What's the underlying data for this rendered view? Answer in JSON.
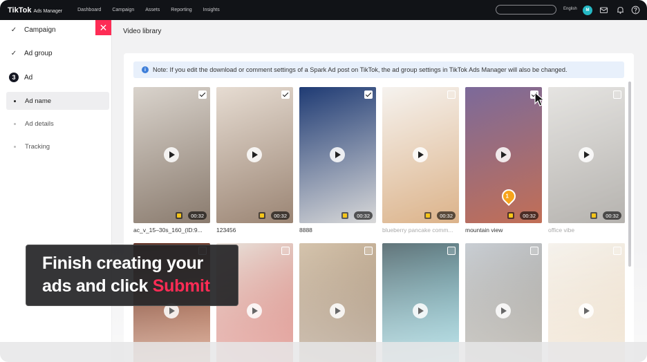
{
  "topbar": {
    "brand": "TikTok",
    "brand_sub": "Ads Manager",
    "nav": [
      "Dashboard",
      "Campaign",
      "Assets",
      "Reporting",
      "Insights"
    ],
    "language": "English",
    "avatar_initial": "M"
  },
  "sidebar": {
    "steps": [
      {
        "label": "Campaign",
        "state": "done"
      },
      {
        "label": "Ad group",
        "state": "done"
      },
      {
        "label": "Ad",
        "state": "current",
        "number": "3"
      }
    ],
    "substeps": [
      {
        "label": "Ad name",
        "active": true
      },
      {
        "label": "Ad details",
        "active": false
      },
      {
        "label": "Tracking",
        "active": false
      }
    ]
  },
  "main": {
    "title": "Video library",
    "note": "Note: If you edit the download or comment settings of a Spark Ad post on TikTok, the ad group settings in TikTok Ads Manager will also be changed."
  },
  "videos": [
    {
      "caption": "ac_v_15–30s_160_(ID:9...",
      "duration": "00:32",
      "checked": true,
      "colors": [
        "#d9d3cc",
        "#8a7b6e"
      ]
    },
    {
      "caption": "123456",
      "duration": "00:32",
      "checked": true,
      "colors": [
        "#e6dcd2",
        "#9b8574"
      ]
    },
    {
      "caption": "8888",
      "duration": "00:32",
      "checked": true,
      "colors": [
        "#1f3b74",
        "#d9d9d9"
      ]
    },
    {
      "caption": "blueberry pancake comm...",
      "duration": "00:32",
      "checked": false,
      "colors": [
        "#f1ece6",
        "#c98a4b"
      ]
    },
    {
      "caption": "mountain view",
      "duration": "00:32",
      "checked": true,
      "colors": [
        "#7c6a9a",
        "#c26f56"
      ]
    },
    {
      "caption": "office vibe",
      "duration": "00:32",
      "checked": false,
      "colors": [
        "#d8d6d2",
        "#8e8a84"
      ]
    },
    {
      "caption": "",
      "duration": "",
      "checked": false,
      "colors": [
        "#5c2a1d",
        "#c4673c"
      ]
    },
    {
      "caption": "",
      "duration": "",
      "checked": false,
      "colors": [
        "#e9e3dc",
        "#c63a2f"
      ]
    },
    {
      "caption": "",
      "duration": "",
      "checked": false,
      "colors": [
        "#d5c4ad",
        "#7b5a3a"
      ]
    },
    {
      "caption": "",
      "duration": "",
      "checked": false,
      "colors": [
        "#0f2b33",
        "#2fb3c8"
      ]
    },
    {
      "caption": "",
      "duration": "",
      "checked": false,
      "colors": [
        "#c9ced4",
        "#7d7464"
      ]
    },
    {
      "caption": "",
      "duration": "",
      "checked": false,
      "colors": [
        "#f1ece4",
        "#d6b07d"
      ]
    }
  ],
  "pin_number": "1",
  "callout": {
    "line1": "Finish creating your",
    "line2_prefix": "ads and click ",
    "line2_highlight": "Submit"
  },
  "accent": "#fe2c55"
}
